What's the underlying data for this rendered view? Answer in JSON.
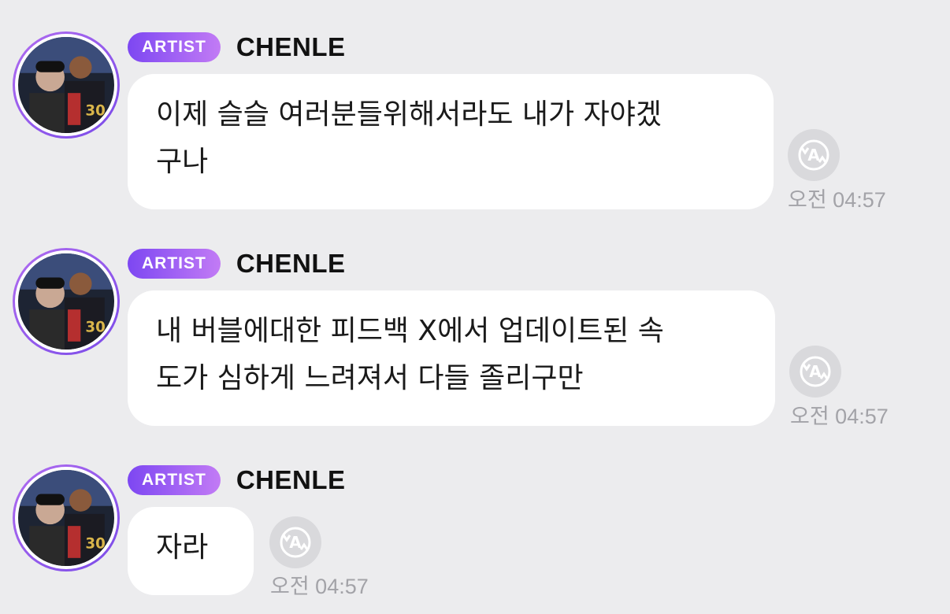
{
  "messages": [
    {
      "badge": "ARTIST",
      "sender": "CHENLE",
      "text_lines": [
        "이제 슬슬 여러분들위해서라도 내가 자야겠",
        "구나"
      ],
      "time": "오전 04:57"
    },
    {
      "badge": "ARTIST",
      "sender": "CHENLE",
      "text_lines": [
        "내 버블에대한 피드백 X에서 업데이트된 속",
        "도가 심하게 느려져서 다들 졸리구만"
      ],
      "time": "오전 04:57"
    },
    {
      "badge": "ARTIST",
      "sender": "CHENLE",
      "text_lines": [
        "자라"
      ],
      "time": "오전 04:57"
    }
  ],
  "icons": {
    "translate": "translate-icon",
    "avatar": "avatar"
  },
  "colors": {
    "background": "#ececee",
    "badge_start": "#7d47f2",
    "badge_end": "#c27bf5",
    "bubble": "#ffffff",
    "timestamp": "#a3a3a8"
  }
}
